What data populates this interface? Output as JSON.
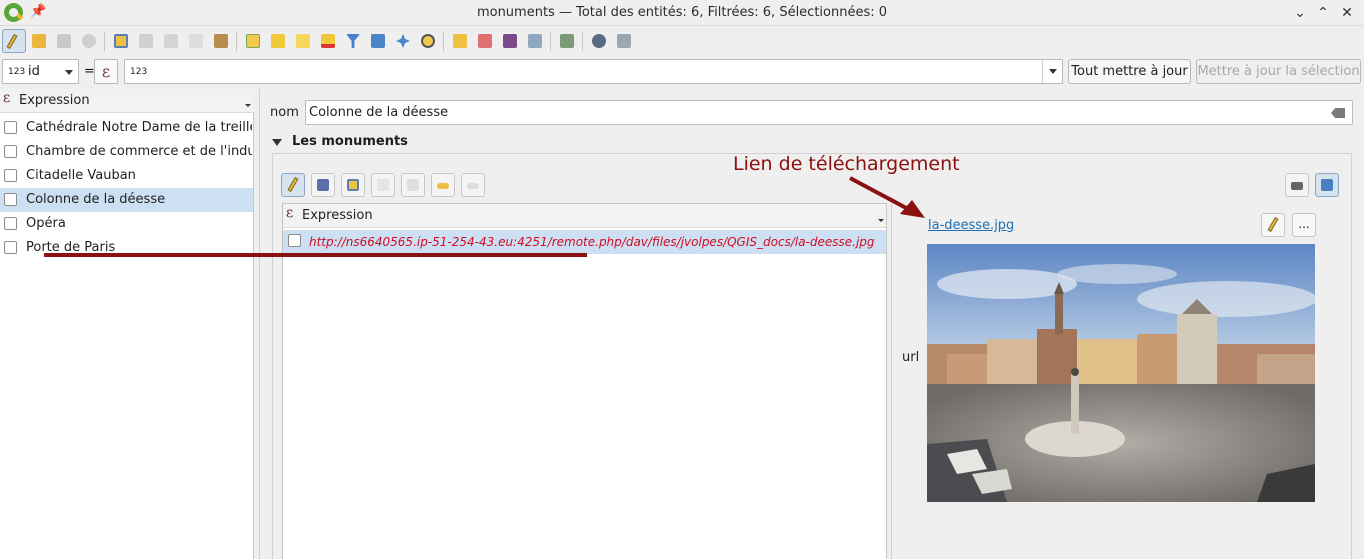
{
  "window": {
    "title": "monuments — Total des entités: 6, Filtrées: 6, Sélectionnées: 0",
    "controls": [
      "minimize",
      "maximize",
      "close"
    ]
  },
  "toolbar": {
    "icons": [
      "toggle-edit-icon",
      "multi-edit-icon",
      "save-icon",
      "reload-icon",
      "add-feature-icon",
      "delete-feature-icon",
      "cut-icon",
      "copy-icon",
      "paste-icon",
      "select-expression-icon",
      "select-all-icon",
      "invert-selection-icon",
      "deselect-icon",
      "filter-icon",
      "move-selection-top-icon",
      "pan-to-selection-icon",
      "zoom-to-selection-icon",
      "new-field-icon",
      "delete-field-icon",
      "field-calculator-icon",
      "conditional-formatting-icon",
      "dock-icon",
      "actions-icon",
      "form-view-icon"
    ]
  },
  "expression_bar": {
    "field_type": "123",
    "field_name": "id",
    "operator": "=",
    "value_type": "123",
    "update_all_label": "Tout mettre à jour",
    "update_selection_label": "Mettre à jour la sélection"
  },
  "feature_list": {
    "header": "Expression",
    "items": [
      {
        "label": "Cathédrale Notre Dame de la treille",
        "selected": false
      },
      {
        "label": "Chambre de commerce et de l'indu...",
        "selected": false
      },
      {
        "label": "Citadelle Vauban",
        "selected": false
      },
      {
        "label": "Colonne de la déesse",
        "selected": true
      },
      {
        "label": "Opéra",
        "selected": false
      },
      {
        "label": "Porte de Paris",
        "selected": false
      }
    ]
  },
  "form": {
    "nom_label": "nom",
    "nom_value": "Colonne de la déesse",
    "group_title": "Les monuments",
    "related_list_header": "Expression",
    "related_item": "http://ns6640565.ip-51-254-43.eu:4251/remote.php/dav/files/jvolpes/QGIS_docs/la-deesse.jpg",
    "url_label": "url",
    "file_link": "la-deesse.jpg",
    "dots_label": "..."
  },
  "annotation": {
    "text": "Lien de téléchargement",
    "color": "#8b1010"
  },
  "colors": {
    "selection": "#cde0f3",
    "link": "#1f6fb2",
    "url_red": "#d10d23"
  }
}
